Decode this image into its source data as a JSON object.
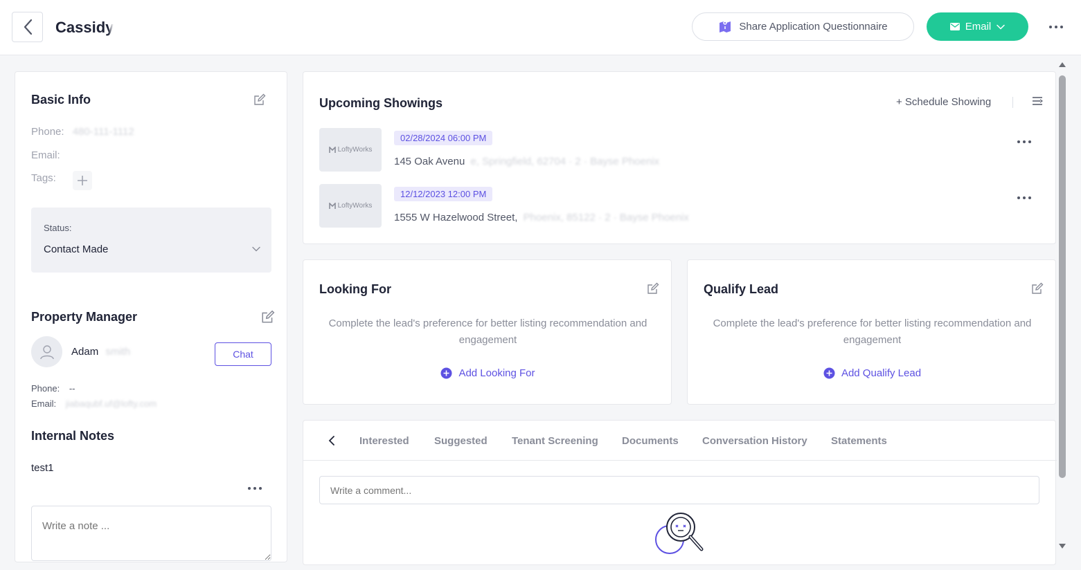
{
  "header": {
    "lead_first_name": "Cassidy",
    "share_label": "Share Application Questionnaire",
    "email_label": "Email"
  },
  "basic_info": {
    "title": "Basic Info",
    "phone_label": "Phone:",
    "phone_value": "480-111-1112",
    "email_label": "Email:",
    "tags_label": "Tags:",
    "status_label": "Status:",
    "status_value": "Contact Made"
  },
  "property_manager": {
    "title": "Property Manager",
    "first_name": "Adam",
    "last_name": "smith",
    "chat_label": "Chat",
    "phone_label": "Phone:",
    "phone_value": "--",
    "email_label": "Email:",
    "email_value": "jiabaqubf.uf@lofty.com"
  },
  "internal_notes": {
    "title": "Internal Notes",
    "notes": [
      "test1"
    ],
    "placeholder": "Write a note ..."
  },
  "showings": {
    "title": "Upcoming Showings",
    "schedule_label": "+ Schedule Showing",
    "thumb_brand": "LoftyWorks",
    "items": [
      {
        "date": "02/28/2024 06:00 PM",
        "address": "145 Oak Avenu",
        "address_rest": "e, Springfield, 62704 · 2 · Bayse Phoenix"
      },
      {
        "date": "12/12/2023 12:00 PM",
        "address": "1555 W Hazelwood Street,",
        "address_rest": "Phoenix, 85122 · 2 · Bayse Phoenix"
      }
    ]
  },
  "looking_for": {
    "title": "Looking For",
    "description": "Complete the lead's preference for better listing recommendation and engagement",
    "add_label": "Add Looking For"
  },
  "qualify_lead": {
    "title": "Qualify Lead",
    "description": "Complete the lead's preference for better listing recommendation and engagement",
    "add_label": "Add Qualify Lead"
  },
  "tabs": {
    "items": [
      "Interested",
      "Suggested",
      "Tenant Screening",
      "Documents",
      "Conversation History",
      "Statements"
    ],
    "comment_placeholder": "Write a comment..."
  },
  "colors": {
    "accent": "#5d51e2",
    "email_green": "#20c997",
    "text_dark": "#202437",
    "text_muted": "#8a8d99"
  }
}
